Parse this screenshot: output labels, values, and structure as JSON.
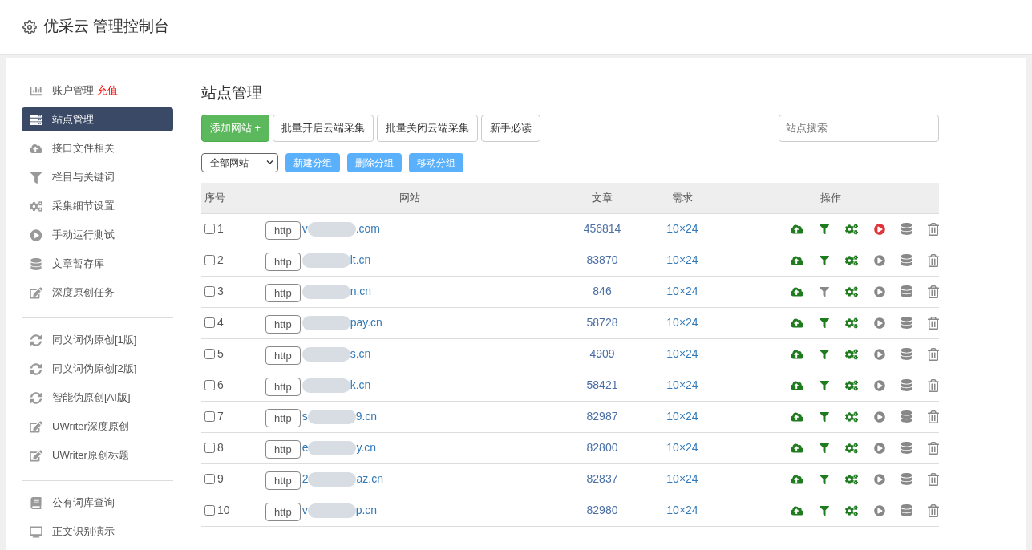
{
  "header": {
    "title": "优采云 管理控制台"
  },
  "sidebar": {
    "groups": [
      {
        "items": [
          {
            "label": "账户管理",
            "badge": "充值",
            "selected": false
          },
          {
            "label": "站点管理",
            "selected": true
          },
          {
            "label": "接口文件相关",
            "selected": false
          },
          {
            "label": "栏目与关键词",
            "selected": false
          },
          {
            "label": "采集细节设置",
            "selected": false
          },
          {
            "label": "手动运行测试",
            "selected": false
          },
          {
            "label": "文章暂存库",
            "selected": false
          },
          {
            "label": "深度原创任务",
            "selected": false
          }
        ]
      },
      {
        "items": [
          {
            "label": "同义词伪原创[1版]",
            "selected": false
          },
          {
            "label": "同义词伪原创[2版]",
            "selected": false
          },
          {
            "label": "智能伪原创[AI版]",
            "selected": false
          },
          {
            "label": "UWriter深度原创",
            "selected": false
          },
          {
            "label": "UWriter原创标题",
            "selected": false
          }
        ]
      },
      {
        "items": [
          {
            "label": "公有词库查询",
            "selected": false
          },
          {
            "label": "正文识别演示",
            "selected": false
          }
        ]
      }
    ]
  },
  "page_title": "站点管理",
  "toolbar": {
    "add_button": "添加网站 +",
    "buttons": [
      "批量开启云端采集",
      "批量关闭云端采集",
      "新手必读"
    ],
    "search": {
      "placeholder": "站点搜索"
    }
  },
  "filter": {
    "select": "全部网站",
    "buttons": [
      "新建分组",
      "删除分组",
      "移动分组"
    ]
  },
  "table": {
    "columns": [
      "序号",
      "网站",
      "文章",
      "需求",
      "操作"
    ],
    "rows": [
      {
        "index": "1",
        "checked": false,
        "scheme": "http",
        "domain_start": "v",
        "domain_end": ".com",
        "articles": "456814",
        "demand": "10×24",
        "filter_on": true,
        "running": true
      },
      {
        "index": "2",
        "checked": false,
        "scheme": "http",
        "domain_end": "lt.cn",
        "articles": "83870",
        "demand": "10×24",
        "filter_on": true,
        "running": false
      },
      {
        "index": "3",
        "checked": false,
        "scheme": "http",
        "domain_end": "n.cn",
        "articles": "846",
        "demand": "10×24",
        "filter_on": false,
        "running": false
      },
      {
        "index": "4",
        "checked": false,
        "scheme": "http",
        "domain_end": "pay.cn",
        "articles": "58728",
        "demand": "10×24",
        "filter_on": true,
        "running": false
      },
      {
        "index": "5",
        "checked": false,
        "scheme": "http",
        "domain_end": "s.cn",
        "articles": "4909",
        "demand": "10×24",
        "filter_on": true,
        "running": false
      },
      {
        "index": "6",
        "checked": false,
        "scheme": "http",
        "domain_end": "k.cn",
        "articles": "58421",
        "demand": "10×24",
        "filter_on": true,
        "running": false
      },
      {
        "index": "7",
        "checked": false,
        "scheme": "http",
        "domain_start": "s",
        "domain_end": "9.cn",
        "articles": "82987",
        "demand": "10×24",
        "filter_on": true,
        "running": false
      },
      {
        "index": "8",
        "checked": false,
        "scheme": "http",
        "domain_start": "e",
        "domain_end": "y.cn",
        "articles": "82800",
        "demand": "10×24",
        "filter_on": true,
        "running": false
      },
      {
        "index": "9",
        "checked": false,
        "scheme": "http",
        "domain_start": "2",
        "domain_end": "az.cn",
        "articles": "82837",
        "demand": "10×24",
        "filter_on": true,
        "running": false
      },
      {
        "index": "10",
        "checked": false,
        "scheme": "http",
        "domain_start": "v",
        "domain_end": "p.cn",
        "articles": "82980",
        "demand": "10×24",
        "filter_on": true,
        "running": false
      }
    ]
  }
}
